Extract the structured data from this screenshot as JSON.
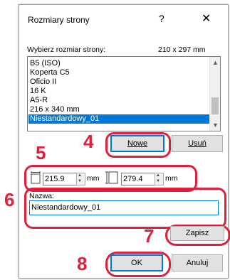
{
  "dialog": {
    "title": "Rozmiary strony",
    "help_label": "?",
    "close_label": "✕"
  },
  "size_list": {
    "label": "Wybierz rozmiar strony:",
    "current_size": "210 x 297 mm",
    "items": [
      {
        "label": "B5 (ISO)"
      },
      {
        "label": "Koperta C5"
      },
      {
        "label": "Oficio II"
      },
      {
        "label": "16 K"
      },
      {
        "label": "A5-R"
      },
      {
        "label": "216 x 340 mm"
      },
      {
        "label": "Niestandardowy_01"
      }
    ],
    "selected_index": 6
  },
  "buttons": {
    "new": "Nowe",
    "delete": "Usuń",
    "save": "Zapisz",
    "ok": "OK",
    "cancel": "Anuluj"
  },
  "dimensions": {
    "width_value": "215.9",
    "height_value": "279.4",
    "unit": "mm"
  },
  "name_field": {
    "label": "Nazwa:",
    "value": "Niestandardowy_01"
  },
  "callouts": {
    "n4": "4",
    "n5": "5",
    "n6": "6",
    "n7": "7",
    "n8": "8"
  },
  "colors": {
    "callout": "#e0203a",
    "selection": "#0078d7"
  }
}
